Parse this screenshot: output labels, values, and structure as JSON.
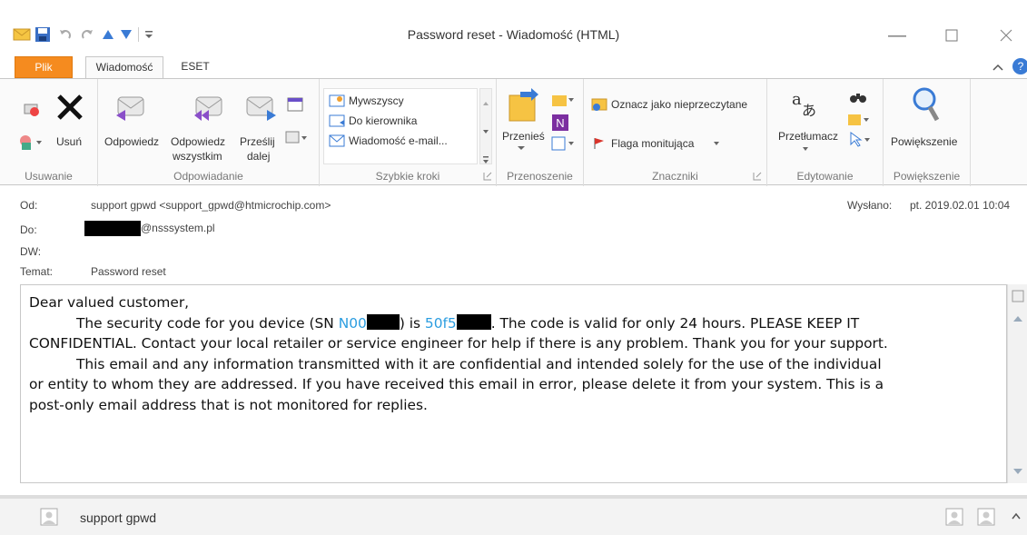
{
  "window": {
    "title": "Password reset - Wiadomość (HTML)"
  },
  "tabs": {
    "file": "Plik",
    "message": "Wiadomość",
    "eset": "ESET"
  },
  "ribbon": {
    "delete_group": {
      "label": "Usuwanie",
      "delete_btn": "Usuń"
    },
    "respond_group": {
      "label": "Odpowiadanie",
      "reply": "Odpowiedz",
      "reply_all_1": "Odpowiedz",
      "reply_all_2": "wszystkim",
      "forward_1": "Prześlij",
      "forward_2": "dalej"
    },
    "quick_steps": {
      "label": "Szybkie kroki",
      "items": [
        "Mywszyscy",
        "Do kierownika",
        "Wiadomość e-mail..."
      ]
    },
    "move_group": {
      "label": "Przenoszenie",
      "move": "Przenieś"
    },
    "tags_group": {
      "label": "Znaczniki",
      "unread": "Oznacz jako nieprzeczytane",
      "flag": "Flaga monitująca"
    },
    "edit_group": {
      "label": "Edytowanie",
      "translate": "Przetłumacz"
    },
    "zoom_group": {
      "label": "Powiększenie",
      "zoom": "Powiększenie"
    }
  },
  "header": {
    "from_label": "Od:",
    "from_value": "support gpwd <support_gpwd@htmicrochip.com>",
    "to_label": "Do:",
    "to_value": "@nsssystem.pl",
    "cc_label": "DW:",
    "subject_label": "Temat:",
    "subject_value": "Password reset",
    "sent_label": "Wysłano:",
    "sent_value": "pt. 2019.02.01 10:04"
  },
  "body": {
    "greeting": "Dear valued customer,",
    "l2a": "The security code for you device (SN ",
    "sn": "N00",
    "l2b": ") is ",
    "code": "50f5",
    "l2c": ". The code is valid for only 24 hours. PLEASE KEEP IT",
    "l3": "CONFIDENTIAL. Contact your local retailer or service engineer for help if there is any problem. Thank you for your support.",
    "l4": "This email and any information transmitted with it are confidential and intended solely for the use of the individual",
    "l5": "or entity to whom they are addressed. If you have received this email in error, please delete it from your system. This is a",
    "l6": "post-only email address that is not monitored for replies."
  },
  "footer": {
    "sender_name": "support gpwd"
  },
  "colors": {
    "accent": "#f58b1f",
    "link": "#2b9de0"
  }
}
